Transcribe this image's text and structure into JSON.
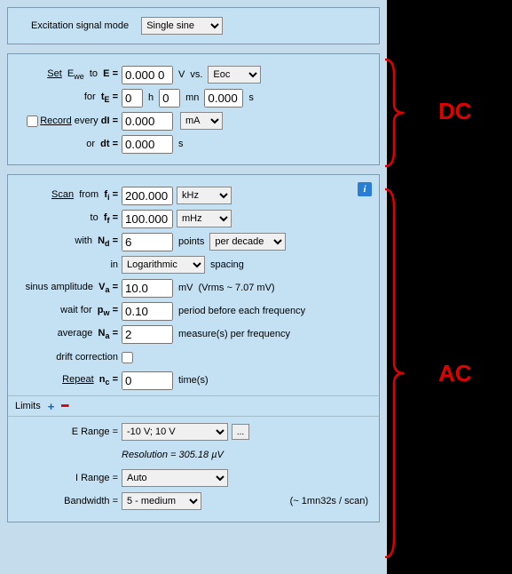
{
  "mode_panel": {
    "label": "Excitation signal mode",
    "value": "Single sine"
  },
  "dc_panel": {
    "set_label_pre": "Set",
    "set_label_var_html": "E<sub>we</sub>",
    "set_label_to": "to",
    "E_label": "E =",
    "E_value": "0.000 0",
    "E_unit": "V",
    "vs_label": "vs.",
    "vs_ref": "Eoc",
    "for_label": "for",
    "tE_label_html": "t<sub>E</sub> =",
    "tE_h": "0",
    "h_unit": "h",
    "tE_mn": "0",
    "mn_unit": "mn",
    "tE_s": "0.000",
    "s_unit": "s",
    "record_label": "Record",
    "every_label": "every",
    "dI_label": "dI =",
    "dI_value": "0.000",
    "dI_unit": "mA",
    "or_label": "or",
    "dt_label": "dt =",
    "dt_value": "0.000",
    "dt_unit": "s"
  },
  "ac_panel": {
    "scan_label": "Scan",
    "from_label": "from",
    "fi_label_html": "f<sub>i</sub> =",
    "fi_value": "200.000",
    "fi_unit": "kHz",
    "to_label": "to",
    "ff_label_html": "f<sub>f</sub> =",
    "ff_value": "100.000",
    "ff_unit": "mHz",
    "with_label": "with",
    "Nd_label_html": "N<sub>d</sub> =",
    "Nd_value": "6",
    "points_label": "points",
    "per_mode": "per decade",
    "in_label": "in",
    "spacing_mode": "Logarithmic",
    "spacing_label": "spacing",
    "sinus_label": "sinus amplitude",
    "Va_label_html": "V<sub>a</sub> =",
    "Va_value": "10.0",
    "Va_unit": "mV",
    "vrms_label": "(Vrms ~ 7.07 mV)",
    "wait_label": "wait for",
    "pw_label_html": "p<sub>w</sub> =",
    "pw_value": "0.10",
    "pw_suffix": "period before each frequency",
    "avg_label": "average",
    "Na_label_html": "N<sub>a</sub> =",
    "Na_value": "2",
    "Na_suffix": "measure(s) per frequency",
    "drift_label": "drift correction",
    "repeat_label": "Repeat",
    "nc_label_html": "n<sub>c</sub> =",
    "nc_value": "0",
    "nc_suffix": "time(s)",
    "limits_label": "Limits",
    "erange_label": "E Range =",
    "erange_value": "-10 V; 10 V",
    "resolution_label": "Resolution = 305.18 µV",
    "irange_label": "I Range =",
    "irange_value": "Auto",
    "bw_label": "Bandwidth =",
    "bw_value": "5 - medium",
    "scan_time": "(~ 1mn32s / scan)"
  },
  "side": {
    "dc": "DC",
    "ac": "AC"
  }
}
